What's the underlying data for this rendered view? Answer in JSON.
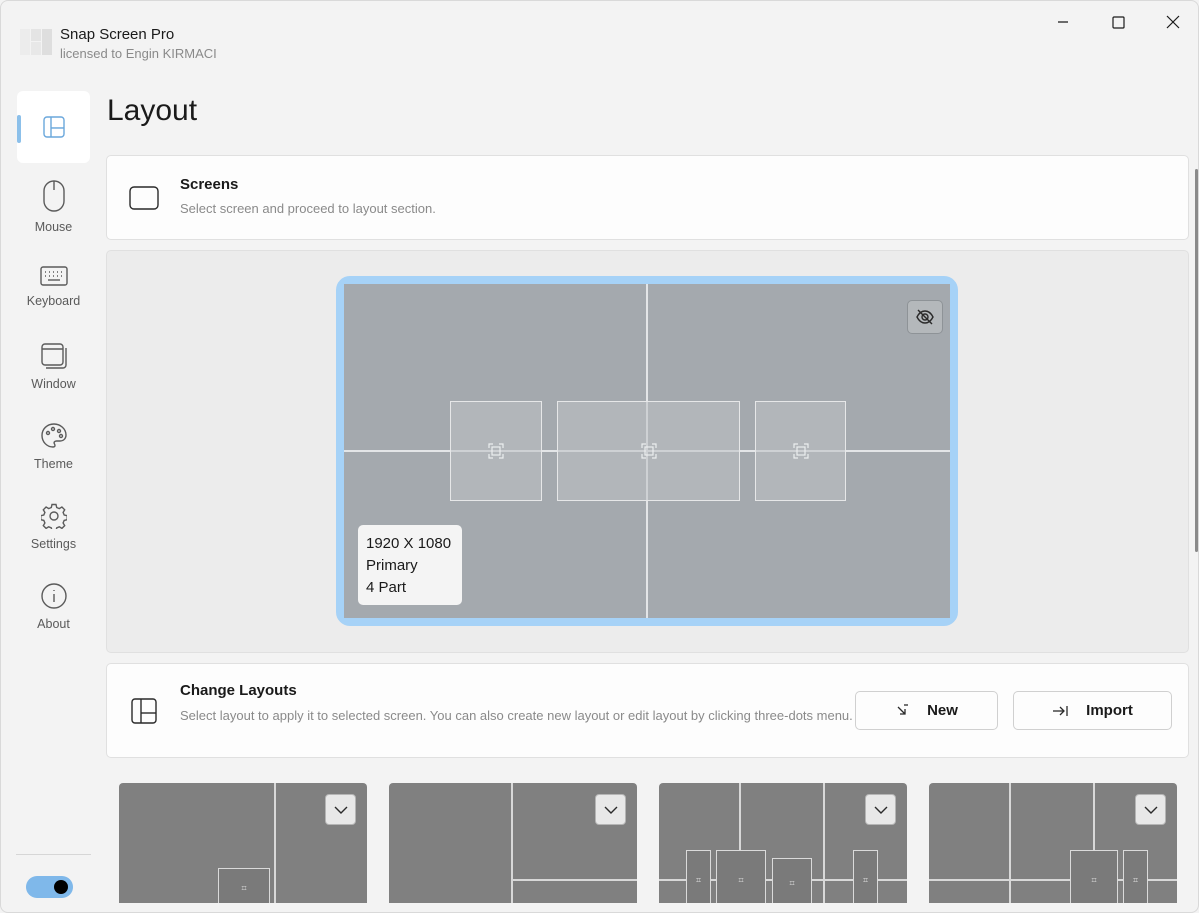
{
  "app": {
    "title": "Snap Screen Pro",
    "license": "licensed to Engin KIRMACI"
  },
  "window_controls": [
    "minimize",
    "maximize",
    "close"
  ],
  "sidebar": {
    "items": [
      {
        "label": "",
        "icon": "layout-icon",
        "active": true
      },
      {
        "label": "Mouse",
        "icon": "mouse-icon"
      },
      {
        "label": "Keyboard",
        "icon": "keyboard-icon"
      },
      {
        "label": "Window",
        "icon": "window-icon"
      },
      {
        "label": "Theme",
        "icon": "palette-icon"
      },
      {
        "label": "Settings",
        "icon": "gear-icon"
      },
      {
        "label": "About",
        "icon": "info-icon"
      }
    ],
    "theme_toggle_on": true
  },
  "page": {
    "title": "Layout"
  },
  "screens_card": {
    "title": "Screens",
    "description": "Select screen and proceed to layout section."
  },
  "monitor": {
    "resolution": "1920 X 1080",
    "role": "Primary",
    "parts": "4 Part"
  },
  "layouts_card": {
    "title": "Change Layouts",
    "description": "Select layout to apply it to selected screen. You can also create new layout or edit layout by clicking three-dots menu.",
    "new_label": "New",
    "import_label": "Import"
  },
  "colors": {
    "accent": "#a6d2f7",
    "toggle": "#7fb8ea",
    "monitor_bg": "#a4a9ae",
    "thumb_bg": "#808080"
  }
}
